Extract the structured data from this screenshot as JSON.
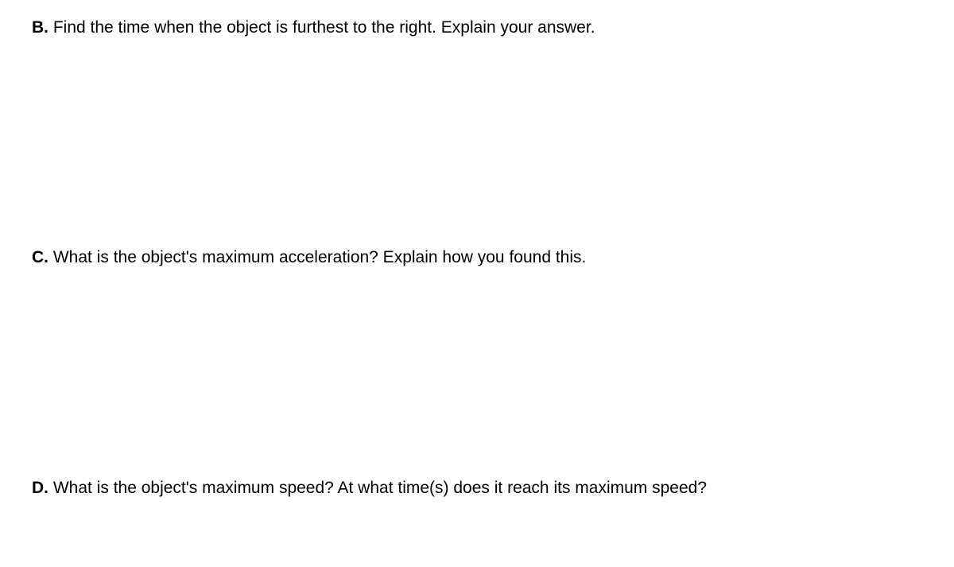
{
  "questions": [
    {
      "label": "B.",
      "text": "Find the time when the object is furthest to the right. Explain your answer."
    },
    {
      "label": "C.",
      "text": "What is the object's maximum acceleration? Explain how you found this."
    },
    {
      "label": "D.",
      "text": "What is the object's maximum speed? At what time(s) does it reach its maximum speed?"
    }
  ]
}
